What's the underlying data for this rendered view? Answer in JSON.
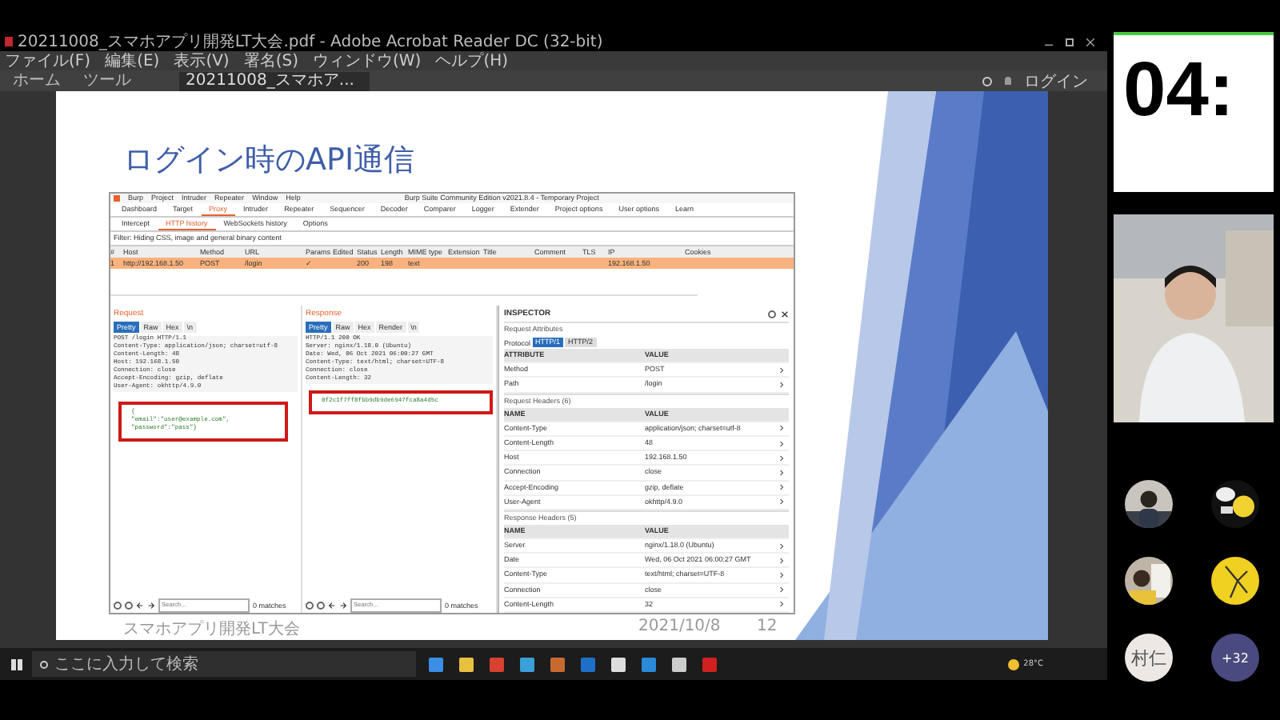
{
  "acrobat": {
    "title": "20211008_スマホアプリ開発LT大会.pdf - Adobe Acrobat Reader DC (32-bit)",
    "menu": [
      "ファイル(F)",
      "編集(E)",
      "表示(V)",
      "署名(S)",
      "ウィンドウ(W)",
      "ヘルプ(H)"
    ],
    "tabs": [
      {
        "label": "ホーム",
        "selected": false
      },
      {
        "label": "ツール",
        "selected": false
      },
      {
        "label": "20211008_スマホア...",
        "selected": true
      }
    ],
    "login": "ログイン"
  },
  "slide": {
    "title": "ログイン時のAPI通信",
    "footer": "スマホアプリ開発LT大会",
    "date": "2021/10/8",
    "page": "12",
    "burp": {
      "title": "Burp Suite Community Edition v2021.8.4 - Temporary Project",
      "menu": [
        "Burp",
        "Project",
        "Intruder",
        "Repeater",
        "Window",
        "Help"
      ],
      "tabs": [
        {
          "label": "Dashboard",
          "selected": false
        },
        {
          "label": "Target",
          "selected": false
        },
        {
          "label": "Proxy",
          "selected": true
        },
        {
          "label": "Intruder",
          "selected": false
        },
        {
          "label": "Repeater",
          "selected": false
        },
        {
          "label": "Sequencer",
          "selected": false
        },
        {
          "label": "Decoder",
          "selected": false
        },
        {
          "label": "Comparer",
          "selected": false
        },
        {
          "label": "Logger",
          "selected": false
        },
        {
          "label": "Extender",
          "selected": false
        },
        {
          "label": "Project options",
          "selected": false
        },
        {
          "label": "User options",
          "selected": false
        },
        {
          "label": "Learn",
          "selected": false
        }
      ],
      "subtabs": [
        {
          "label": "Intercept",
          "selected": false
        },
        {
          "label": "HTTP history",
          "selected": true
        },
        {
          "label": "WebSockets history",
          "selected": false
        },
        {
          "label": "Options",
          "selected": false
        }
      ],
      "filter": "Filter: Hiding CSS, image and general binary content",
      "columns": [
        "#",
        "Host",
        "Method",
        "URL",
        "Params",
        "Edited",
        "Status",
        "Length",
        "MIME type",
        "Extension",
        "Title",
        "Comment",
        "TLS",
        "IP",
        "Cookies"
      ],
      "rows": [
        {
          "selected": true,
          "cells": [
            "1",
            "http://192.168.1.50",
            "POST",
            "/login",
            "✓",
            "",
            "200",
            "198",
            "text",
            "",
            "",
            "",
            "",
            "192.168.1.50",
            ""
          ]
        }
      ],
      "request": {
        "title": "Request",
        "buttons": [
          {
            "label": "Pretty",
            "selected": true
          },
          {
            "label": "Raw",
            "selected": false
          },
          {
            "label": "Hex",
            "selected": false
          },
          {
            "label": "\\n",
            "selected": false
          }
        ],
        "lines": [
          "POST /login HTTP/1.1",
          "Content-Type: application/json; charset=utf-8",
          "Content-Length: 48",
          "Host: 192.168.1.50",
          "Connection: close",
          "Accept-Encoding: gzip, deflate",
          "User-Agent: okhttp/4.9.0"
        ],
        "body": [
          "{",
          "\"email\":\"user@example.com\",",
          "\"password\":\"pass\"}"
        ]
      },
      "response": {
        "title": "Response",
        "buttons": [
          {
            "label": "Pretty",
            "selected": true
          },
          {
            "label": "Raw",
            "selected": false
          },
          {
            "label": "Hex",
            "selected": false
          },
          {
            "label": "Render",
            "selected": false
          },
          {
            "label": "\\n",
            "selected": false
          }
        ],
        "lines": [
          "HTTP/1.1 200 OK",
          "Server: nginx/1.18.0 (Ubuntu)",
          "Date: Wed, 06 Oct 2021 06:00:27 GMT",
          "Content-Type: text/html; charset=UTF-8",
          "Connection: close",
          "Content-Length: 32"
        ],
        "body": [
          "0f2c1f7ff8fbb9db9de6947fca8a4d5c"
        ]
      },
      "search": [
        {
          "placeholder": "Search...",
          "matches": "0 matches"
        },
        {
          "placeholder": "Search...",
          "matches": "0 matches"
        }
      ],
      "inspector": {
        "title": "INSPECTOR",
        "sections": [
          {
            "title": "Request Attributes",
            "protocol_label": "Protocol",
            "protocols": [
              {
                "label": "HTTP/1",
                "selected": true
              },
              {
                "label": "HTTP/2",
                "selected": false
              }
            ],
            "columns": [
              "ATTRIBUTE",
              "VALUE"
            ],
            "rows": [
              [
                "Method",
                "POST"
              ],
              [
                "Path",
                "/login"
              ]
            ]
          },
          {
            "title": "Request Headers (6)",
            "columns": [
              "NAME",
              "VALUE"
            ],
            "rows": [
              [
                "Content-Type",
                "application/json; charset=utf-8"
              ],
              [
                "Content-Length",
                "48"
              ],
              [
                "Host",
                "192.168.1.50"
              ],
              [
                "Connection",
                "close"
              ],
              [
                "Accept-Encoding",
                "gzip, deflate"
              ],
              [
                "User-Agent",
                "okhttp/4.9.0"
              ]
            ]
          },
          {
            "title": "Response Headers (5)",
            "columns": [
              "NAME",
              "VALUE"
            ],
            "rows": [
              [
                "Server",
                "nginx/1.18.0 (Ubuntu)"
              ],
              [
                "Date",
                "Wed, 06 Oct 2021 06:00:27 GMT"
              ],
              [
                "Content-Type",
                "text/html; charset=UTF-8"
              ],
              [
                "Connection",
                "close"
              ],
              [
                "Content-Length",
                "32"
              ]
            ]
          }
        ]
      }
    }
  },
  "taskbar": {
    "search_placeholder": "ここに入力して検索",
    "weather": "28°C"
  },
  "call": {
    "timer": "04:",
    "participants": [
      {
        "kind": "picture"
      },
      {
        "kind": "picture"
      },
      {
        "kind": "picture"
      },
      {
        "kind": "picture"
      },
      {
        "kind": "initials",
        "label": "村仁"
      },
      {
        "kind": "more",
        "label": "+32"
      }
    ]
  }
}
